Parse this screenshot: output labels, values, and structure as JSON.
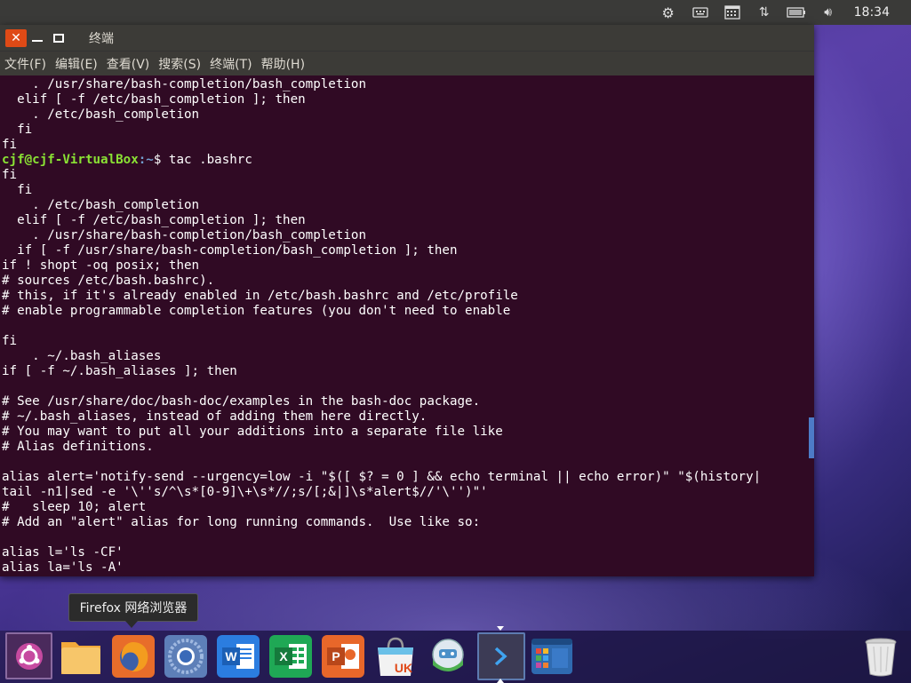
{
  "top_panel": {
    "icons": [
      "gear-weather-icon",
      "keyboard-icon",
      "calendar-icon",
      "network-arrows-icon",
      "battery-icon",
      "volume-icon"
    ],
    "clock": "18:34"
  },
  "window": {
    "title": "终端",
    "menu": [
      "文件(F)",
      "编辑(E)",
      "查看(V)",
      "搜索(S)",
      "终端(T)",
      "帮助(H)"
    ]
  },
  "terminal": {
    "prompt_user": "cjf@cjf-VirtualBox",
    "prompt_path": ":~",
    "prompt_cmd": "$ tac .bashrc",
    "lines_before": [
      "    . /usr/share/bash-completion/bash_completion",
      "  elif [ -f /etc/bash_completion ]; then",
      "    . /etc/bash_completion",
      "  fi",
      "fi"
    ],
    "lines_after": [
      "fi",
      "  fi",
      "    . /etc/bash_completion",
      "  elif [ -f /etc/bash_completion ]; then",
      "    . /usr/share/bash-completion/bash_completion",
      "  if [ -f /usr/share/bash-completion/bash_completion ]; then",
      "if ! shopt -oq posix; then",
      "# sources /etc/bash.bashrc).",
      "# this, if it's already enabled in /etc/bash.bashrc and /etc/profile",
      "# enable programmable completion features (you don't need to enable",
      "",
      "fi",
      "    . ~/.bash_aliases",
      "if [ -f ~/.bash_aliases ]; then",
      "",
      "# See /usr/share/doc/bash-doc/examples in the bash-doc package.",
      "# ~/.bash_aliases, instead of adding them here directly.",
      "# You may want to put all your additions into a separate file like",
      "# Alias definitions.",
      "",
      "alias alert='notify-send --urgency=low -i \"$([ $? = 0 ] && echo terminal || echo error)\" \"$(history|",
      "tail -n1|sed -e '\\''s/^\\s*[0-9]\\+\\s*//;s/[;&|]\\s*alert$//'\\'')\"'",
      "#   sleep 10; alert",
      "# Add an \"alert\" alias for long running commands.  Use like so:",
      "",
      "alias l='ls -CF'",
      "alias la='ls -A'"
    ]
  },
  "tooltip": {
    "text": "Firefox 网络浏览器"
  },
  "dock": {
    "items": [
      {
        "name": "ubuntu-dash-icon",
        "color": "#6b3a7a"
      },
      {
        "name": "files-icon",
        "color": "#f5a623"
      },
      {
        "name": "firefox-icon",
        "color": "#e8561e"
      },
      {
        "name": "chromium-icon",
        "color": "#5d7fb8"
      },
      {
        "name": "wps-writer-icon",
        "color": "#2b7de0"
      },
      {
        "name": "wps-spreadsheets-icon",
        "color": "#1fa855"
      },
      {
        "name": "wps-presentation-icon",
        "color": "#e8672a"
      },
      {
        "name": "ubuntu-software-icon",
        "color": "#f0f0f0"
      },
      {
        "name": "system-settings-icon",
        "color": "#4caf50"
      },
      {
        "name": "terminal-icon",
        "color": "#3c3b55"
      },
      {
        "name": "workspace-switcher-icon",
        "color": "#2f6ab0"
      }
    ],
    "trash": "trash-icon",
    "uk_label": "UK"
  }
}
